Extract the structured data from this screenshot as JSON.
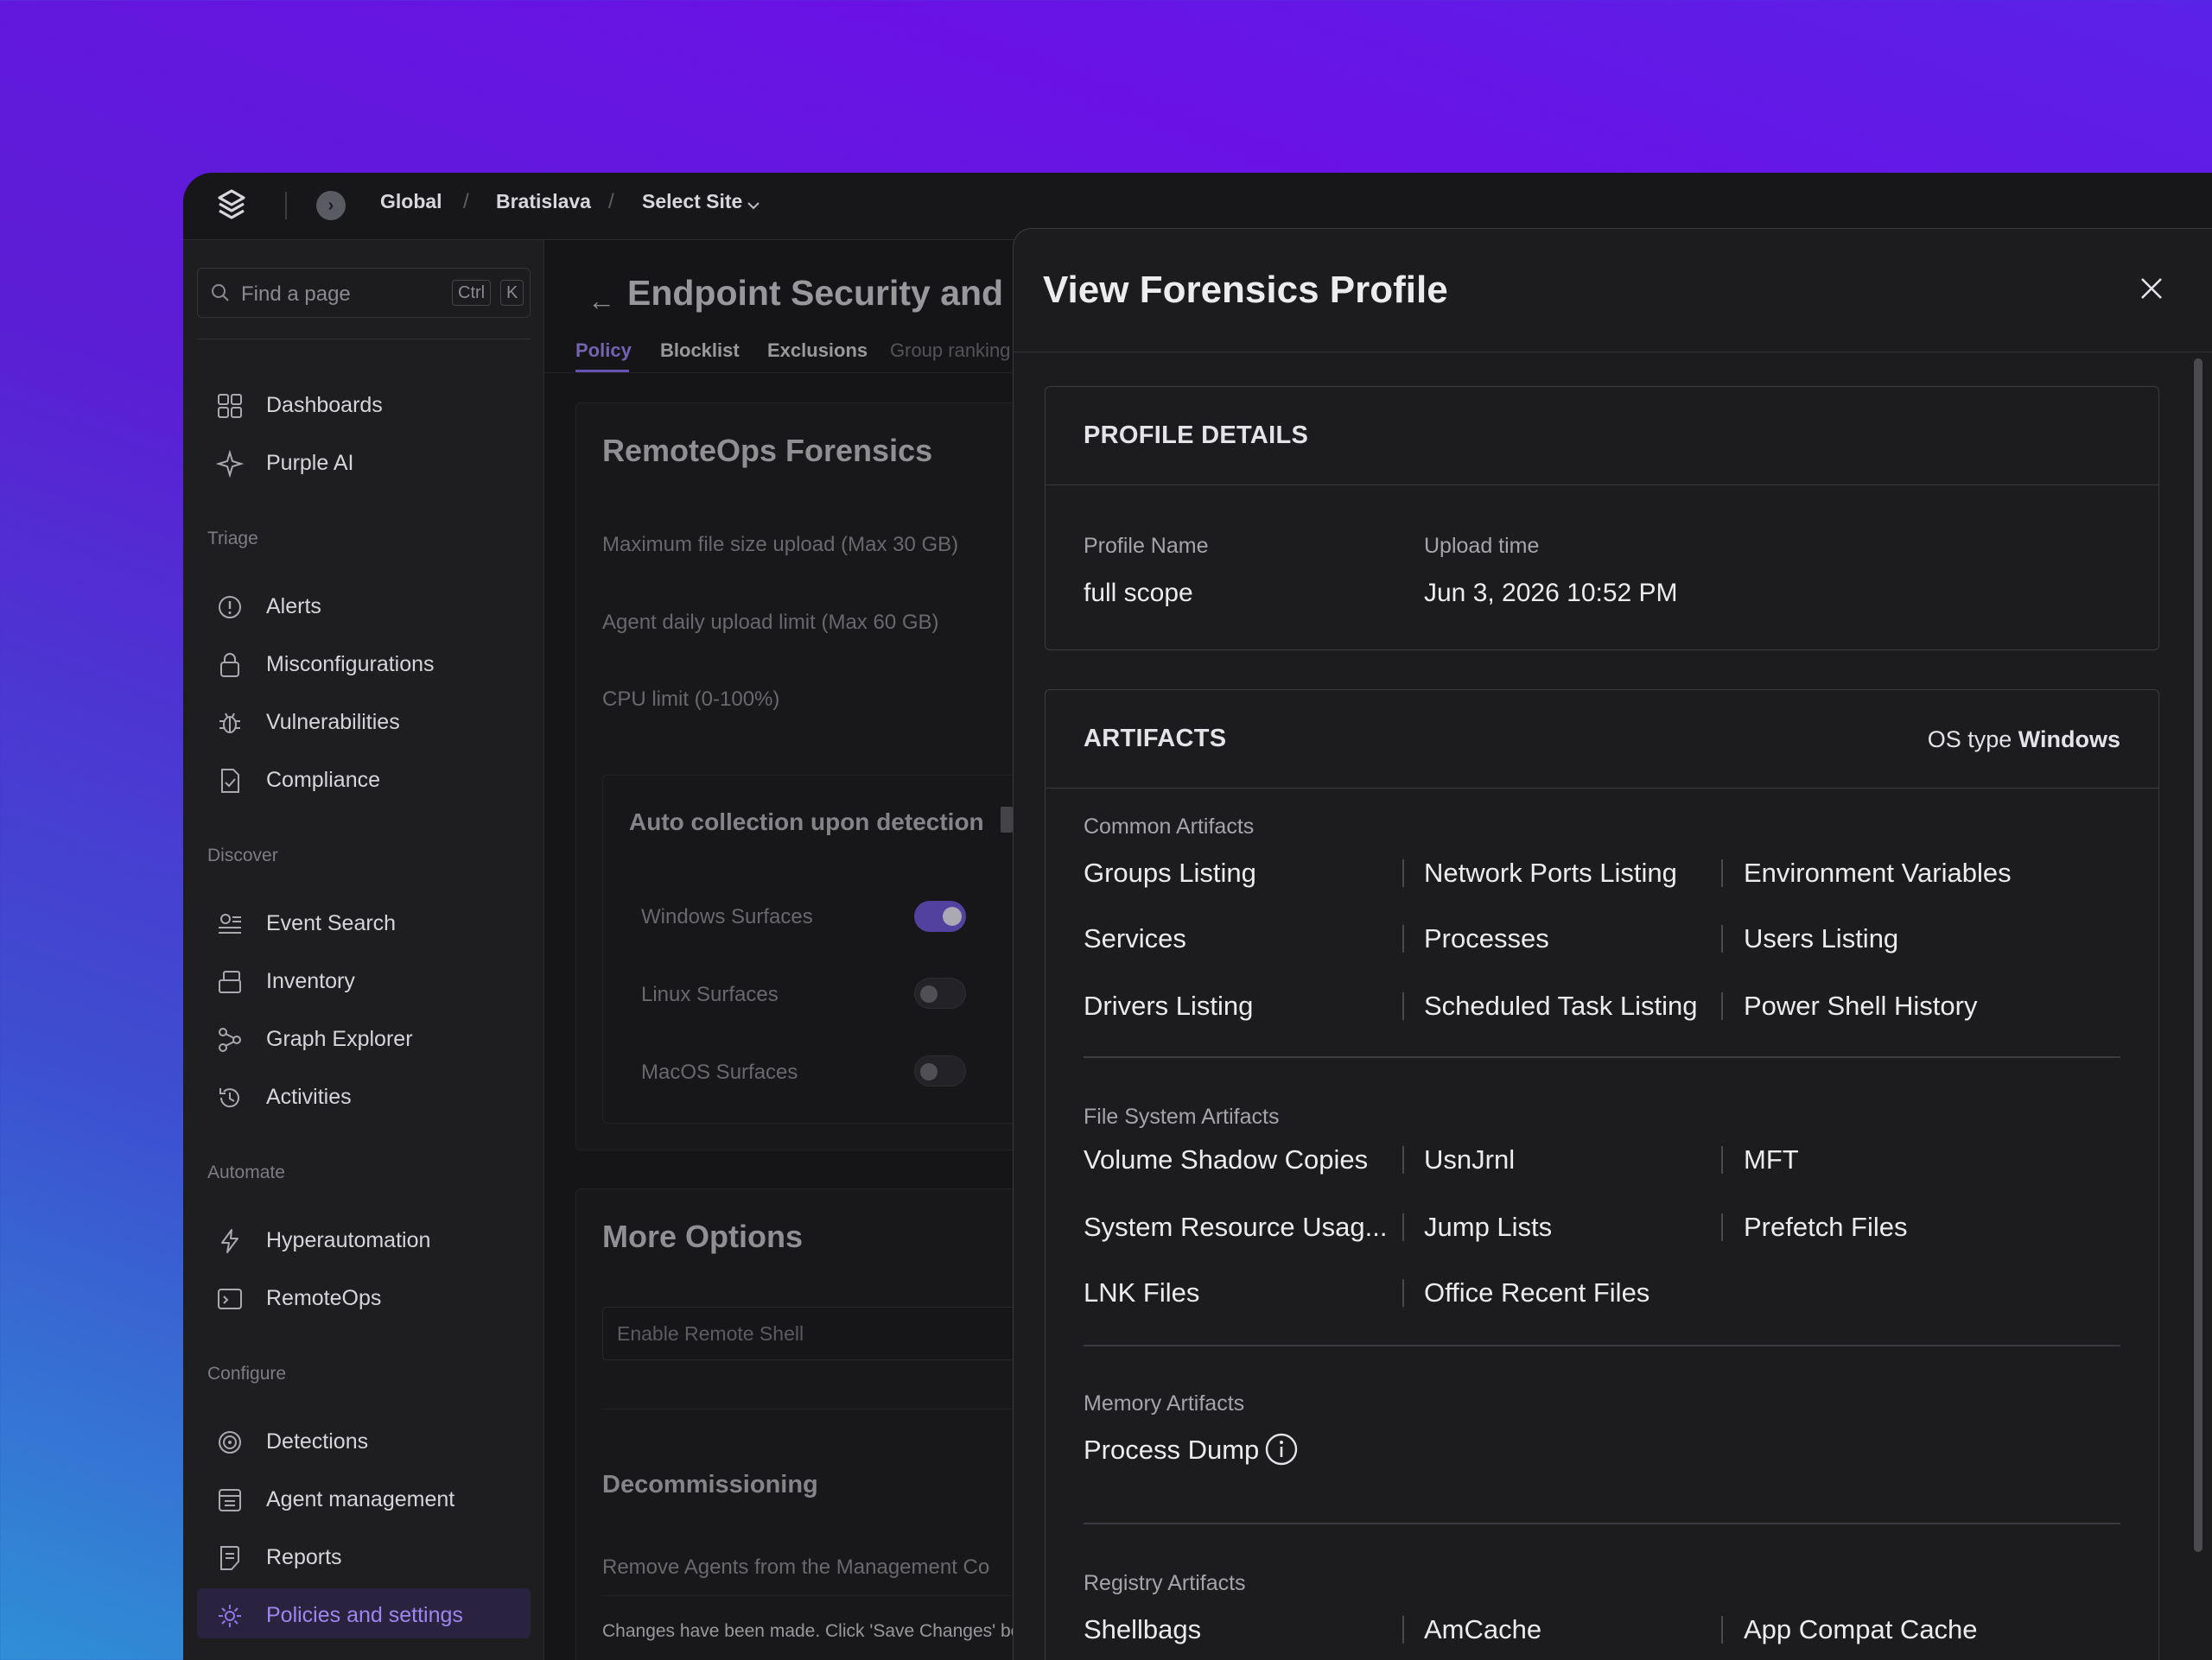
{
  "topbar": {
    "breadcrumbs": [
      "Global",
      "Bratislava",
      "Select Site"
    ],
    "select_site_caret": "⌵"
  },
  "sidebar": {
    "search": {
      "placeholder": "Find a page",
      "shortcut_ctrl": "Ctrl",
      "shortcut_key": "K"
    },
    "top_items": [
      {
        "label": "Dashboards",
        "icon": "grid-icon"
      },
      {
        "label": "Purple AI",
        "icon": "sparkle-icon"
      }
    ],
    "sections": [
      {
        "title": "Triage",
        "items": [
          {
            "label": "Alerts",
            "icon": "alert-icon"
          },
          {
            "label": "Misconfigurations",
            "icon": "lock-icon"
          },
          {
            "label": "Vulnerabilities",
            "icon": "bug-icon"
          },
          {
            "label": "Compliance",
            "icon": "document-check-icon"
          }
        ]
      },
      {
        "title": "Discover",
        "items": [
          {
            "label": "Event Search",
            "icon": "list-search-icon"
          },
          {
            "label": "Inventory",
            "icon": "inventory-icon"
          },
          {
            "label": "Graph Explorer",
            "icon": "graph-icon"
          },
          {
            "label": "Activities",
            "icon": "history-icon"
          }
        ]
      },
      {
        "title": "Automate",
        "items": [
          {
            "label": "Hyperautomation",
            "icon": "bolt-icon"
          },
          {
            "label": "RemoteOps",
            "icon": "terminal-icon"
          }
        ]
      },
      {
        "title": "Configure",
        "items": [
          {
            "label": "Detections",
            "icon": "radar-icon"
          },
          {
            "label": "Agent management",
            "icon": "agent-icon"
          },
          {
            "label": "Reports",
            "icon": "report-icon"
          },
          {
            "label": "Policies and settings",
            "icon": "settings-icon",
            "active": true
          }
        ]
      }
    ]
  },
  "main": {
    "title": "Endpoint Security and Cl",
    "tabs": [
      {
        "label": "Policy",
        "active": true
      },
      {
        "label": "Blocklist"
      },
      {
        "label": "Exclusions"
      },
      {
        "label": "Group ranking"
      }
    ],
    "forensics_card": {
      "title": "RemoteOps Forensics",
      "fields": [
        "Maximum file size upload (Max 30 GB)",
        "Agent daily upload limit (Max 60 GB)",
        "CPU limit (0-100%)"
      ],
      "auto_collection": {
        "title": "Auto collection upon detection",
        "surfaces": [
          {
            "label": "Windows Surfaces",
            "on": true
          },
          {
            "label": "Linux Surfaces",
            "on": false
          },
          {
            "label": "MacOS Surfaces",
            "on": false
          }
        ]
      }
    },
    "more_options": {
      "title": "More Options",
      "remote_shell_placeholder": "Enable Remote Shell",
      "decommissioning_title": "Decommissioning",
      "decommissioning_text": "Remove Agents from the Management Co"
    },
    "footer_note": "Changes have been made. Click 'Save Changes' be"
  },
  "drawer": {
    "title": "View Forensics Profile",
    "profile_details": {
      "heading": "PROFILE DETAILS",
      "name_label": "Profile Name",
      "name_value": "full scope",
      "upload_label": "Upload time",
      "upload_value": "Jun 3, 2026 10:52 PM"
    },
    "artifacts": {
      "heading": "ARTIFACTS",
      "os_type_label": "OS type",
      "os_type_value": "Windows",
      "groups": [
        {
          "title": "Common Artifacts",
          "items": [
            "Groups Listing",
            "Network Ports Listing",
            "Environment Variables",
            "Services",
            "Processes",
            "Users Listing",
            "Drivers Listing",
            "Scheduled Task Listing",
            "Power Shell History"
          ]
        },
        {
          "title": "File System Artifacts",
          "items": [
            "Volume Shadow Copies",
            "UsnJrnl",
            "MFT",
            "System Resource Usag...",
            "Jump Lists",
            "Prefetch Files",
            "LNK Files",
            "Office Recent Files"
          ]
        },
        {
          "title": "Memory Artifacts",
          "items": [
            "Process Dump"
          ]
        },
        {
          "title": "Registry Artifacts",
          "items": [
            "Shellbags",
            "AmCache",
            "App Compat Cache"
          ]
        }
      ]
    }
  },
  "colors": {
    "accent": "#8b6cf0",
    "background_gradient_top": "#5a22e8",
    "background_gradient_bottom": "#2f8fd6",
    "panel": "#1c1c1f"
  }
}
